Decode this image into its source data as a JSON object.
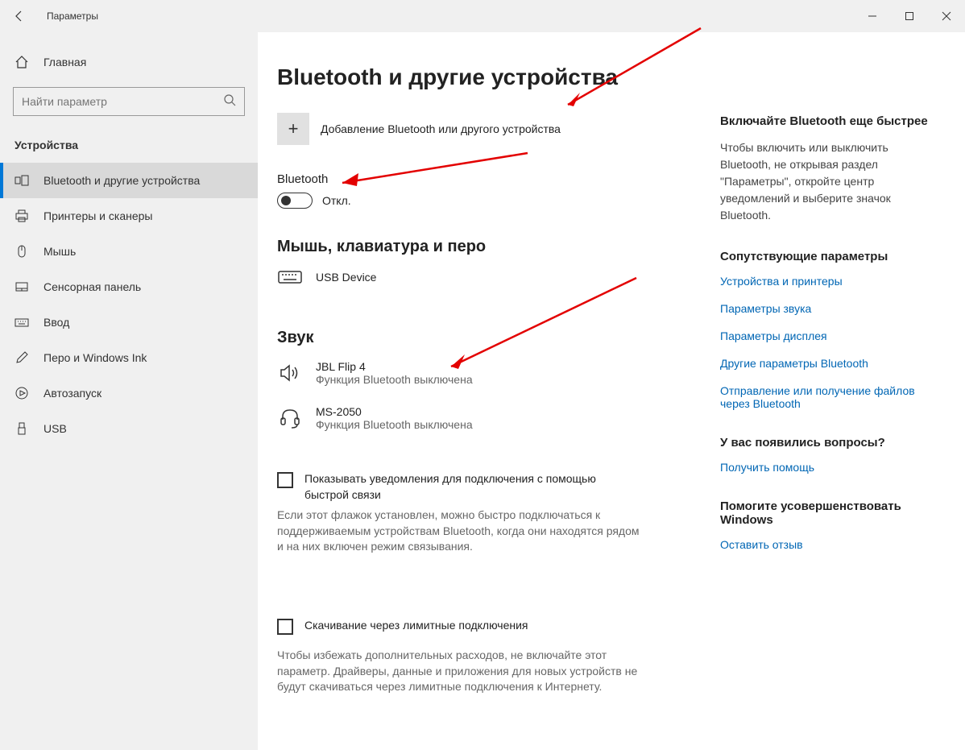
{
  "window": {
    "title": "Параметры"
  },
  "sidebar": {
    "home": "Главная",
    "search_placeholder": "Найти параметр",
    "category": "Устройства",
    "items": [
      {
        "label": "Bluetooth и другие устройства"
      },
      {
        "label": "Принтеры и сканеры"
      },
      {
        "label": "Мышь"
      },
      {
        "label": "Сенсорная панель"
      },
      {
        "label": "Ввод"
      },
      {
        "label": "Перо и Windows Ink"
      },
      {
        "label": "Автозапуск"
      },
      {
        "label": "USB"
      }
    ]
  },
  "main": {
    "title": "Bluetooth и другие устройства",
    "add_device": "Добавление Bluetooth или другого устройства",
    "bt_label": "Bluetooth",
    "toggle_state": "Откл.",
    "section_mkp": "Мышь, клавиатура и перо",
    "mkp_device": "USB Device",
    "section_sound": "Звук",
    "sound_devices": [
      {
        "name": "JBL Flip 4",
        "status": "Функция Bluetooth выключена"
      },
      {
        "name": "MS-2050",
        "status": "Функция Bluetooth выключена"
      }
    ],
    "checkbox1_label": "Показывать уведомления для подключения с помощью быстрой связи",
    "checkbox1_desc": "Если этот флажок установлен, можно быстро подключаться к поддерживаемым устройствам Bluetooth, когда они находятся рядом и на них включен режим связывания.",
    "checkbox2_label": "Скачивание через лимитные подключения",
    "checkbox2_desc": "Чтобы избежать дополнительных расходов, не включайте этот параметр. Драйверы, данные и приложения для новых устройств не будут скачиваться через лимитные подключения к Интернету."
  },
  "side": {
    "tip_title": "Включайте Bluetooth еще быстрее",
    "tip_body": "Чтобы включить или выключить Bluetooth, не открывая раздел \"Параметры\", откройте центр уведомлений и выберите значок Bluetooth.",
    "related_title": "Сопутствующие параметры",
    "links": [
      "Устройства и принтеры",
      "Параметры звука",
      "Параметры дисплея",
      "Другие параметры Bluetooth",
      "Отправление или получение файлов через Bluetooth"
    ],
    "questions_title": "У вас появились вопросы?",
    "help_link": "Получить помощь",
    "improve_title": "Помогите усовершенствовать Windows",
    "feedback_link": "Оставить отзыв"
  }
}
